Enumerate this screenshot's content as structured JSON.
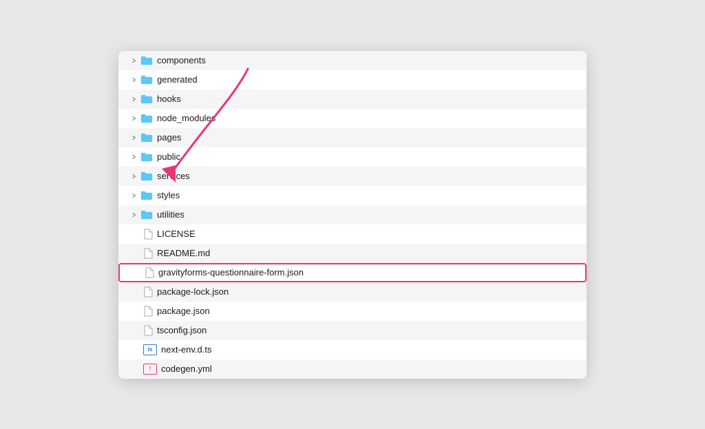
{
  "explorer": {
    "items": [
      {
        "id": "components",
        "type": "folder",
        "label": "components",
        "indent": 0,
        "highlighted": false
      },
      {
        "id": "generated",
        "type": "folder",
        "label": "generated",
        "indent": 0,
        "highlighted": false
      },
      {
        "id": "hooks",
        "type": "folder",
        "label": "hooks",
        "indent": 0,
        "highlighted": false
      },
      {
        "id": "node_modules",
        "type": "folder",
        "label": "node_modules",
        "indent": 0,
        "highlighted": false
      },
      {
        "id": "pages",
        "type": "folder",
        "label": "pages",
        "indent": 0,
        "highlighted": false
      },
      {
        "id": "public",
        "type": "folder",
        "label": "public",
        "indent": 0,
        "highlighted": false
      },
      {
        "id": "services",
        "type": "folder",
        "label": "services",
        "indent": 0,
        "highlighted": false
      },
      {
        "id": "styles",
        "type": "folder",
        "label": "styles",
        "indent": 0,
        "highlighted": false
      },
      {
        "id": "utilities",
        "type": "folder",
        "label": "utilities",
        "indent": 0,
        "highlighted": false
      },
      {
        "id": "LICENSE",
        "type": "file",
        "label": "LICENSE",
        "indent": 0,
        "highlighted": false
      },
      {
        "id": "README_md",
        "type": "file",
        "label": "README.md",
        "indent": 0,
        "highlighted": false
      },
      {
        "id": "gravityforms",
        "type": "file",
        "label": "gravityforms-questionnaire-form.json",
        "indent": 0,
        "highlighted": true
      },
      {
        "id": "package_lock",
        "type": "file",
        "label": "package-lock.json",
        "indent": 0,
        "highlighted": false
      },
      {
        "id": "package_json",
        "type": "file",
        "label": "package.json",
        "indent": 0,
        "highlighted": false
      },
      {
        "id": "tsconfig",
        "type": "file",
        "label": "tsconfig.json",
        "indent": 0,
        "highlighted": false
      },
      {
        "id": "next_env",
        "type": "file_ts",
        "label": "next-env.d.ts",
        "indent": 0,
        "highlighted": false
      },
      {
        "id": "codegen",
        "type": "file_yaml",
        "label": "codegen.yml",
        "indent": 0,
        "highlighted": false
      }
    ]
  },
  "colors": {
    "folder": "#5bc8f5",
    "arrow": "#e8347a",
    "highlight_border": "#e8347a"
  }
}
